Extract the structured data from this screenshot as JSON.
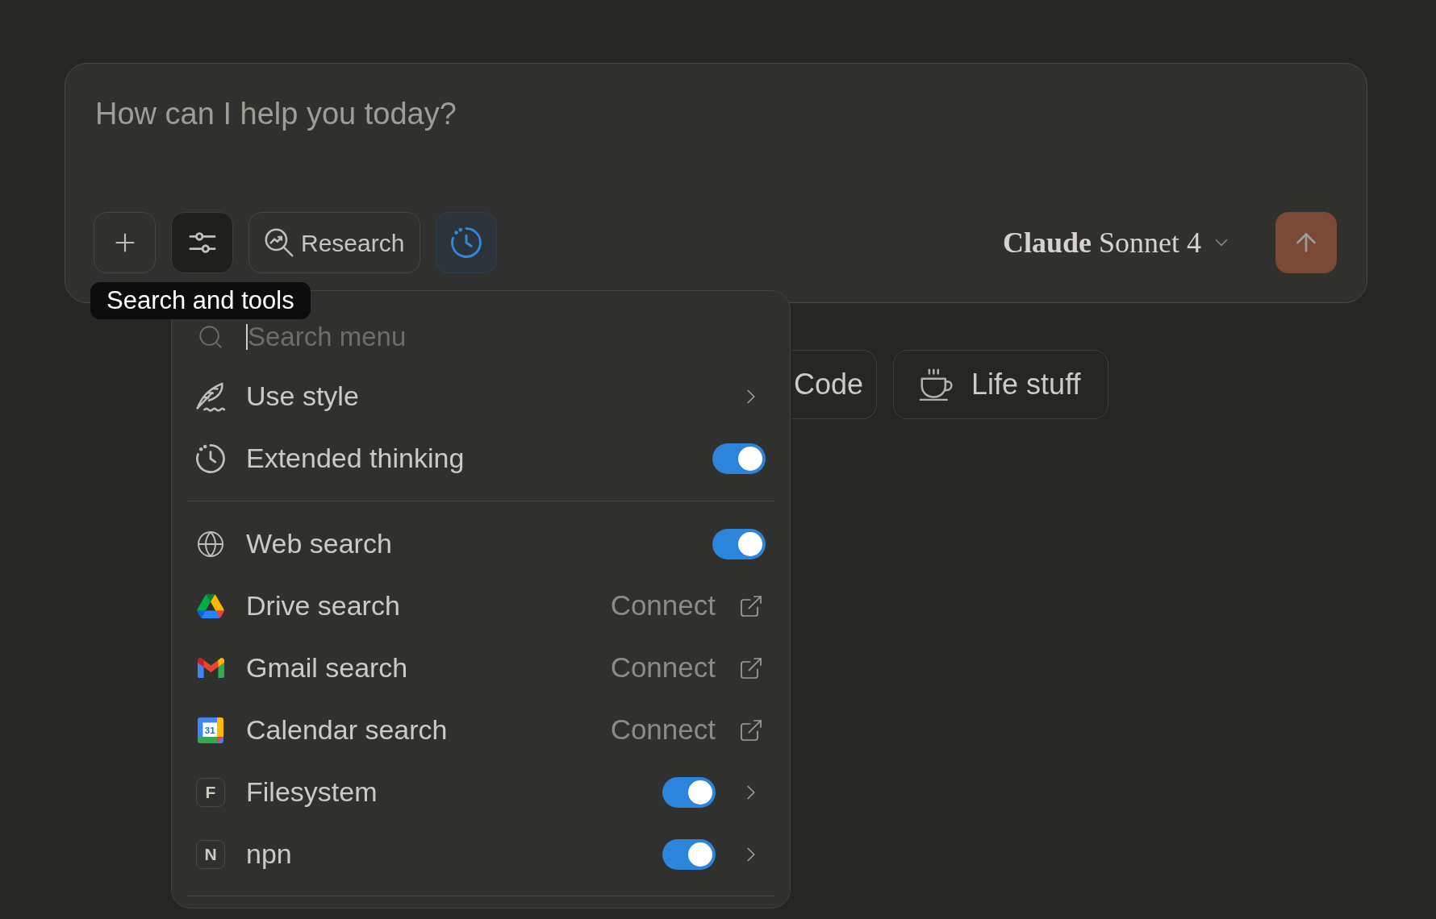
{
  "composer": {
    "placeholder": "How can I help you today?",
    "toolbar": [
      {
        "kind": "add",
        "selected": false
      },
      {
        "kind": "tools",
        "selected": true
      },
      {
        "kind": "research",
        "label": "Research",
        "selected": false
      },
      {
        "kind": "thinking",
        "selected": true
      }
    ],
    "model": "**Claude** Sonnet 4",
    "send": {
      "disabled": true
    }
  },
  "tooltip": {
    "text": "Search and tools"
  },
  "menu": {
    "search": {
      "placeholder": "Search menu",
      "focused": true
    },
    "sections": [
      {
        "items": [
          {
            "kind": "submenu",
            "label": "Use style"
          },
          {
            "kind": "toggle",
            "label": "Extended thinking",
            "on": true
          }
        ]
      },
      {
        "items": [
          {
            "kind": "toggle",
            "label": "Web search",
            "on": true
          },
          {
            "kind": "connect",
            "label": "Drive search",
            "action": "Connect"
          },
          {
            "kind": "connect",
            "label": "Gmail search",
            "action": "Connect"
          },
          {
            "kind": "connect",
            "label": "Calendar search",
            "action": "Connect",
            "logo_text": "31"
          },
          {
            "kind": "toggle_submenu",
            "label": "Filesystem",
            "initial": "F",
            "on": true
          },
          {
            "kind": "toggle_submenu",
            "label": "npn",
            "initial": "N",
            "on": true
          }
        ]
      }
    ]
  },
  "chips": [
    {
      "label": "Code"
    },
    {
      "label": "Life stuff"
    }
  ]
}
